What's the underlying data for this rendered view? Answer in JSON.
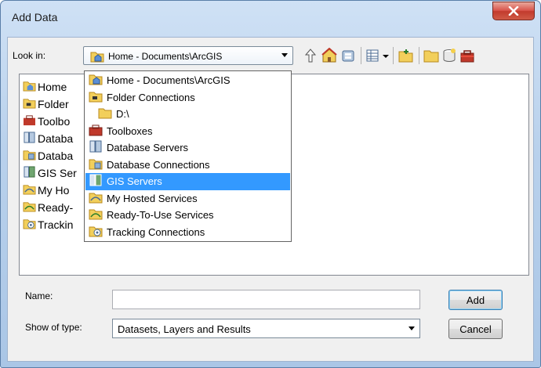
{
  "window": {
    "title": "Add Data"
  },
  "look_in": {
    "label": "Look in:",
    "value": "Home - Documents\\ArcGIS"
  },
  "list_items": [
    {
      "label": "Home",
      "icon": "home-folder-icon"
    },
    {
      "label": "Folder",
      "icon": "folder-connection-icon"
    },
    {
      "label": "Toolbo",
      "icon": "toolbox-icon"
    },
    {
      "label": "Databa",
      "icon": "database-server-icon"
    },
    {
      "label": "Databa",
      "icon": "database-connection-icon"
    },
    {
      "label": "GIS Ser",
      "icon": "gis-server-icon"
    },
    {
      "label": "My Ho",
      "icon": "hosted-services-icon"
    },
    {
      "label": "Ready-",
      "icon": "ready-services-icon"
    },
    {
      "label": "Trackin",
      "icon": "tracking-connection-icon"
    }
  ],
  "dropdown_items": [
    {
      "label": "Home - Documents\\ArcGIS",
      "icon": "home-folder-icon",
      "indent": 0
    },
    {
      "label": "Folder Connections",
      "icon": "folder-connection-icon",
      "indent": 0
    },
    {
      "label": "D:\\",
      "icon": "folder-icon",
      "indent": 1
    },
    {
      "label": "Toolboxes",
      "icon": "toolbox-icon",
      "indent": 0
    },
    {
      "label": "Database Servers",
      "icon": "database-server-icon",
      "indent": 0
    },
    {
      "label": "Database Connections",
      "icon": "database-connection-icon",
      "indent": 0
    },
    {
      "label": "GIS Servers",
      "icon": "gis-server-icon",
      "indent": 0,
      "selected": true
    },
    {
      "label": "My Hosted Services",
      "icon": "hosted-services-icon",
      "indent": 0
    },
    {
      "label": "Ready-To-Use Services",
      "icon": "ready-services-icon",
      "indent": 0
    },
    {
      "label": "Tracking Connections",
      "icon": "tracking-connection-icon",
      "indent": 0
    }
  ],
  "name": {
    "label": "Name:",
    "value": ""
  },
  "show_type": {
    "label": "Show of type:",
    "value": "Datasets, Layers and Results"
  },
  "buttons": {
    "add": "Add",
    "cancel": "Cancel"
  },
  "colors": {
    "selection": "#3399ff",
    "folder": "#f2cf5b",
    "toolbox": "#c0392b"
  }
}
